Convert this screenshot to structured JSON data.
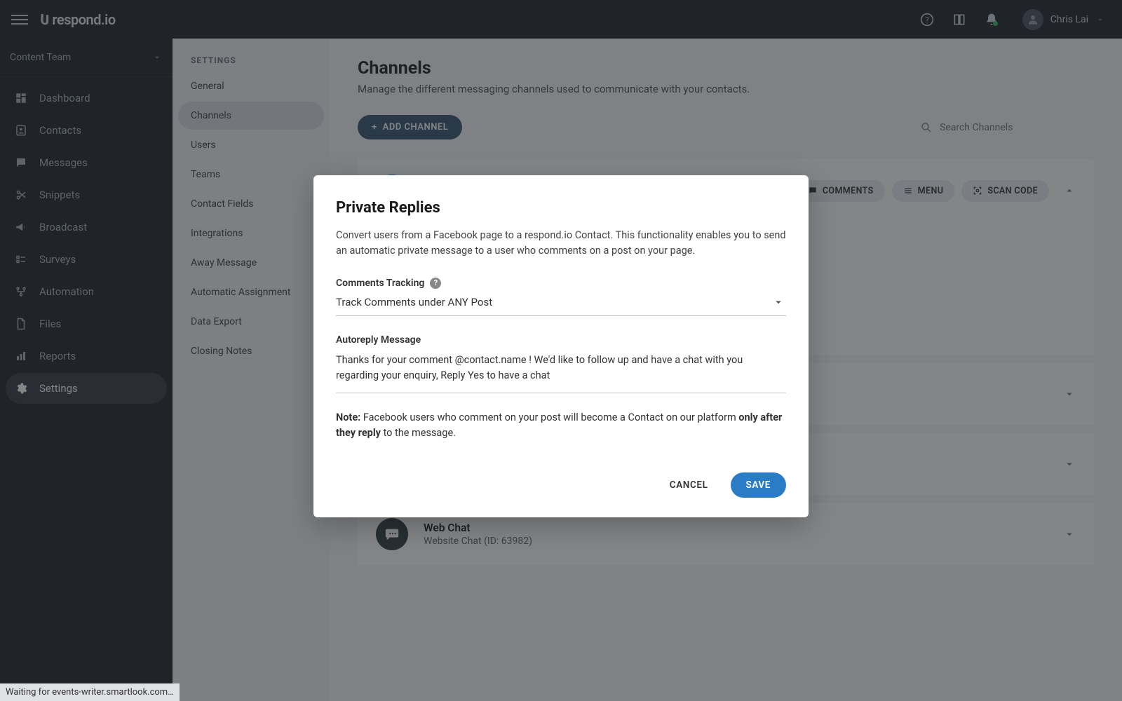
{
  "topbar": {
    "logo_text": "respond.io",
    "username": "Chris Lai"
  },
  "team_select": {
    "label": "Content Team"
  },
  "nav": {
    "items": [
      {
        "label": "Dashboard",
        "icon": "dashboard-icon"
      },
      {
        "label": "Contacts",
        "icon": "contacts-icon"
      },
      {
        "label": "Messages",
        "icon": "messages-icon"
      },
      {
        "label": "Snippets",
        "icon": "snippets-icon"
      },
      {
        "label": "Broadcast",
        "icon": "broadcast-icon"
      },
      {
        "label": "Surveys",
        "icon": "surveys-icon"
      },
      {
        "label": "Automation",
        "icon": "automation-icon"
      },
      {
        "label": "Files",
        "icon": "files-icon"
      },
      {
        "label": "Reports",
        "icon": "reports-icon"
      },
      {
        "label": "Settings",
        "icon": "settings-icon"
      }
    ],
    "active_index": 9
  },
  "settings_sidebar": {
    "heading": "SETTINGS",
    "items": [
      "General",
      "Channels",
      "Users",
      "Teams",
      "Contact Fields",
      "Integrations",
      "Away Message",
      "Automatic Assignment",
      "Data Export",
      "Closing Notes"
    ],
    "active_index": 1
  },
  "page": {
    "title": "Channels",
    "subtitle": "Manage the different messaging channels used to communicate with your contacts.",
    "add_button": "ADD CHANNEL",
    "search_placeholder": "Search Channels",
    "chip_comments": "COMMENTS",
    "chip_menu": "MENU",
    "chip_scan": "SCAN CODE"
  },
  "channels": [
    {
      "name": "Web Chat",
      "sub": "Website Chat (ID: 63982)",
      "icon": "webchat-icon"
    }
  ],
  "modal": {
    "title": "Private Replies",
    "description": "Convert users from a Facebook page to a respond.io Contact. This functionality enables you to send an automatic private message to a user who comments on a post on your page.",
    "comments_tracking_label": "Comments Tracking",
    "comments_tracking_value": "Track Comments under ANY Post",
    "autoreply_label": "Autoreply Message",
    "autoreply_value": "Thanks for your comment @contact.name ! We'd like to follow up and have a chat with you regarding your enquiry, Reply Yes to have a chat",
    "note_prefix": "Note:",
    "note_mid": " Facebook users who comment on your post will become a Contact on our platform ",
    "note_bold": "only after they reply",
    "note_suffix": " to the message.",
    "cancel": "CANCEL",
    "save": "SAVE"
  },
  "status_bar": "Waiting for events-writer.smartlook.com…",
  "colors": {
    "accent": "#2a7cc7",
    "topbar_bg": "#24272d"
  }
}
